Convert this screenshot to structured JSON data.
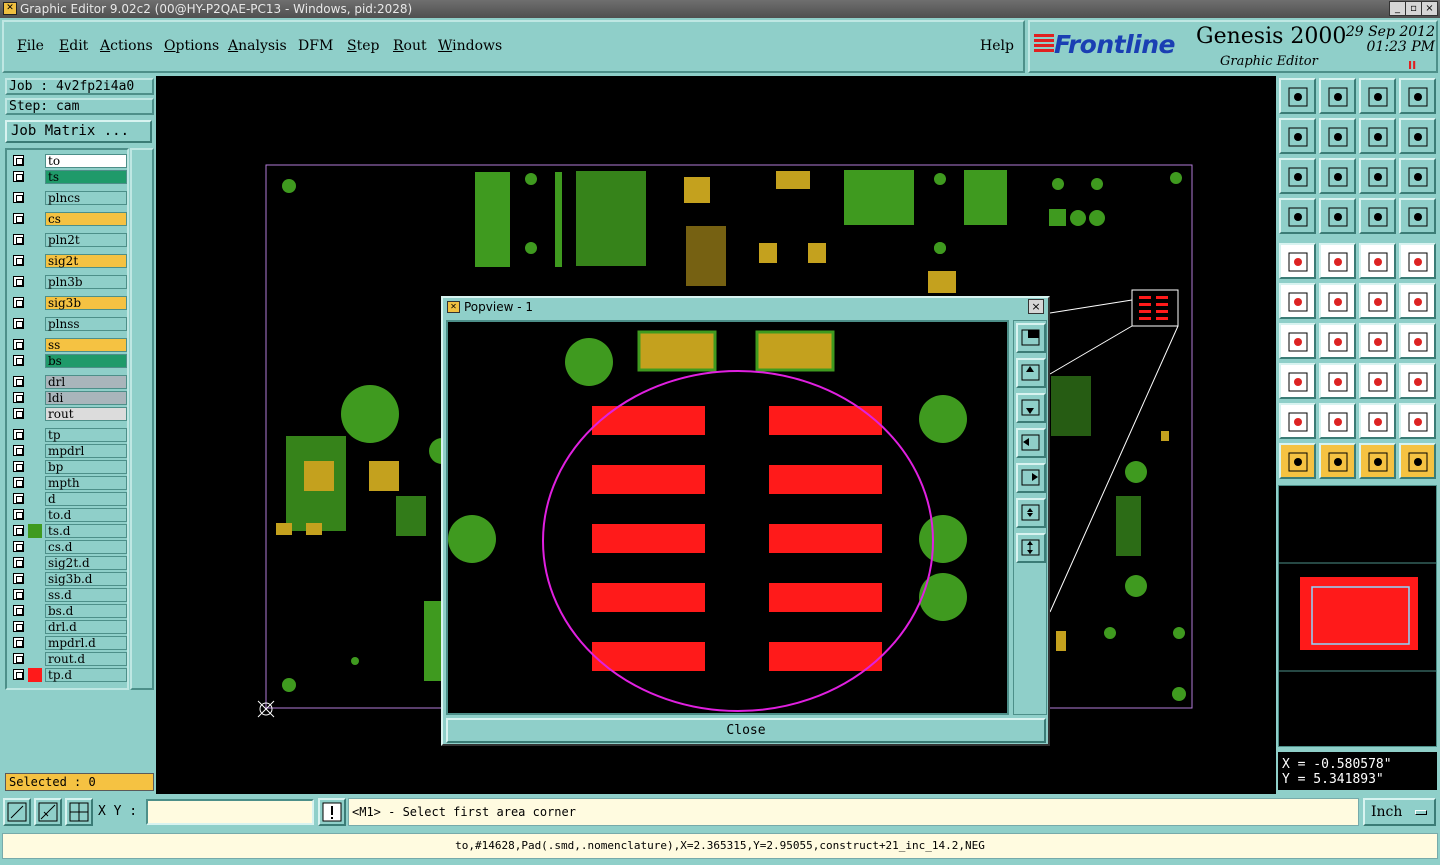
{
  "window": {
    "title": "Graphic Editor 9.02c2 (00@HY-P2QAE-PC13 - Windows, pid:2028)",
    "controls": [
      "_",
      "▫",
      "×"
    ]
  },
  "menu": {
    "items": [
      {
        "label": "File",
        "underline": "F",
        "rest": "ile"
      },
      {
        "label": "Edit",
        "underline": "E",
        "rest": "dit"
      },
      {
        "label": "Actions",
        "underline": "A",
        "rest": "ctions"
      },
      {
        "label": "Options",
        "underline": "O",
        "rest": "ptions"
      },
      {
        "label": "Analysis",
        "underline": "A",
        "rest": "nalysis"
      },
      {
        "label": "DFM",
        "underline": "",
        "rest": "DFM"
      },
      {
        "label": "Step",
        "underline": "S",
        "rest": "tep"
      },
      {
        "label": "Rout",
        "underline": "R",
        "rest": "out"
      },
      {
        "label": "Windows",
        "underline": "W",
        "rest": "indows"
      }
    ],
    "help": "Help"
  },
  "brand": {
    "logo": "Frontline",
    "product": "Genesis 2000",
    "module": "Graphic Editor",
    "date": "29 Sep 2012",
    "time": "01:23 PM",
    "pause": "II"
  },
  "job": {
    "job_text": "Job : 4v2fp2i4a0",
    "step_text": "Step: cam",
    "matrix_button": "Job Matrix ..."
  },
  "layers": [
    {
      "name": "to",
      "color": "#ffffff",
      "swatch": ""
    },
    {
      "name": "ts",
      "color": "#1f9a6a",
      "swatch": ""
    },
    {
      "name": "plncs",
      "color": "#8fcfc9",
      "swatch": ""
    },
    {
      "name": "cs",
      "color": "#f5c242",
      "swatch": ""
    },
    {
      "name": "pln2t",
      "color": "#8fcfc9",
      "swatch": ""
    },
    {
      "name": "sig2t",
      "color": "#f5c242",
      "swatch": ""
    },
    {
      "name": "pln3b",
      "color": "#8fcfc9",
      "swatch": ""
    },
    {
      "name": "sig3b",
      "color": "#f5c242",
      "swatch": ""
    },
    {
      "name": "plnss",
      "color": "#8fcfc9",
      "swatch": ""
    },
    {
      "name": "ss",
      "color": "#f5c242",
      "swatch": ""
    },
    {
      "name": "bs",
      "color": "#1f9a6a",
      "swatch": ""
    },
    {
      "name": "drl",
      "color": "#a9b5bb",
      "swatch": ""
    },
    {
      "name": "ldi",
      "color": "#a9b5bb",
      "swatch": ""
    },
    {
      "name": "rout",
      "color": "#dcdcdc",
      "swatch": ""
    },
    {
      "name": "tp",
      "color": "#8fcfc9",
      "swatch": ""
    },
    {
      "name": "mpdrl",
      "color": "#8fcfc9",
      "swatch": ""
    },
    {
      "name": "bp",
      "color": "#8fcfc9",
      "swatch": ""
    },
    {
      "name": "mpth",
      "color": "#8fcfc9",
      "swatch": ""
    },
    {
      "name": "d",
      "color": "#8fcfc9",
      "swatch": ""
    },
    {
      "name": "to.d",
      "color": "#8fcfc9",
      "swatch": ""
    },
    {
      "name": "ts.d",
      "color": "#8fcfc9",
      "swatch": "#3f9a1f"
    },
    {
      "name": "cs.d",
      "color": "#8fcfc9",
      "swatch": ""
    },
    {
      "name": "sig2t.d",
      "color": "#8fcfc9",
      "swatch": ""
    },
    {
      "name": "sig3b.d",
      "color": "#8fcfc9",
      "swatch": ""
    },
    {
      "name": "ss.d",
      "color": "#8fcfc9",
      "swatch": ""
    },
    {
      "name": "bs.d",
      "color": "#8fcfc9",
      "swatch": ""
    },
    {
      "name": "drl.d",
      "color": "#8fcfc9",
      "swatch": ""
    },
    {
      "name": "mpdrl.d",
      "color": "#8fcfc9",
      "swatch": ""
    },
    {
      "name": "rout.d",
      "color": "#8fcfc9",
      "swatch": ""
    },
    {
      "name": "tp.d",
      "color": "#8fcfc9",
      "swatch": "#ff1a1a"
    }
  ],
  "selected": "Selected : 0",
  "coords": {
    "x": "X = -0.580578\"",
    "y": "Y = 5.341893\""
  },
  "bottom": {
    "xy_label": "X Y :",
    "xy_value": "",
    "prompt": "<M1> - Select first area corner",
    "unit": "Inch"
  },
  "status": "to,#14628,Pad(.smd,.nomenclature),X=2.365315,Y=2.95055,construct+21_inc_14.2,NEG",
  "popview": {
    "title": "Popview - 1",
    "close_label": "Close"
  },
  "colors": {
    "panel": "#8fcfc9",
    "pad_green": "#3f9a1f",
    "pad_gold": "#c4a11e",
    "smd_red": "#ff1a1a",
    "highlight": "#e020e0"
  }
}
